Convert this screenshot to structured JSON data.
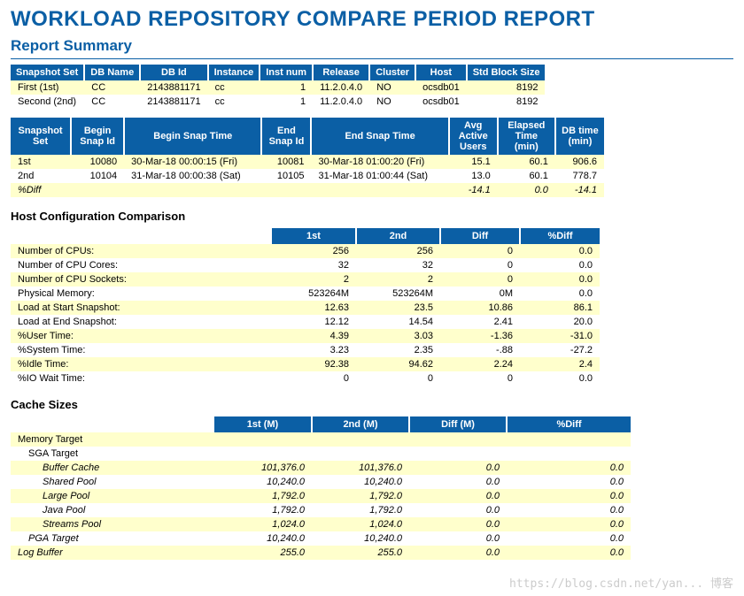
{
  "title": "WORKLOAD REPOSITORY COMPARE PERIOD REPORT",
  "summary_heading": "Report Summary",
  "snapshot_headers": [
    "Snapshot Set",
    "DB Name",
    "DB Id",
    "Instance",
    "Inst num",
    "Release",
    "Cluster",
    "Host",
    "Std Block Size"
  ],
  "snapshot_rows": [
    {
      "set": "First (1st)",
      "dbname": "CC",
      "dbid": "2143881171",
      "inst": "cc",
      "instnum": "1",
      "rel": "11.2.0.4.0",
      "cluster": "NO",
      "host": "ocsdb01",
      "block": "8192"
    },
    {
      "set": "Second (2nd)",
      "dbname": "CC",
      "dbid": "2143881171",
      "inst": "cc",
      "instnum": "1",
      "rel": "11.2.0.4.0",
      "cluster": "NO",
      "host": "ocsdb01",
      "block": "8192"
    }
  ],
  "snap_time_headers": [
    "Snapshot Set",
    "Begin Snap Id",
    "Begin Snap Time",
    "End Snap Id",
    "End Snap Time",
    "Avg Active Users",
    "Elapsed Time (min)",
    "DB time (min)"
  ],
  "snap_time_rows": [
    {
      "set": "1st",
      "bid": "10080",
      "btime": "30-Mar-18 00:00:15 (Fri)",
      "eid": "10081",
      "etime": "30-Mar-18 01:00:20 (Fri)",
      "aau": "15.1",
      "elapsed": "60.1",
      "dbtime": "906.6"
    },
    {
      "set": "2nd",
      "bid": "10104",
      "btime": "31-Mar-18 00:00:38 (Sat)",
      "eid": "10105",
      "etime": "31-Mar-18 01:00:44 (Sat)",
      "aau": "13.0",
      "elapsed": "60.1",
      "dbtime": "778.7"
    }
  ],
  "snap_diff": {
    "label": "%Diff",
    "aau": "-14.1",
    "elapsed": "0.0",
    "dbtime": "-14.1"
  },
  "hostconf_heading": "Host Configuration Comparison",
  "hostconf_headers": [
    "",
    "1st",
    "2nd",
    "Diff",
    "%Diff"
  ],
  "hostconf_rows": [
    {
      "n": "Number of CPUs:",
      "a": "256",
      "b": "256",
      "d": "0",
      "p": "0.0"
    },
    {
      "n": "Number of CPU Cores:",
      "a": "32",
      "b": "32",
      "d": "0",
      "p": "0.0"
    },
    {
      "n": "Number of CPU Sockets:",
      "a": "2",
      "b": "2",
      "d": "0",
      "p": "0.0"
    },
    {
      "n": "Physical Memory:",
      "a": "523264M",
      "b": "523264M",
      "d": "0M",
      "p": "0.0"
    },
    {
      "n": "Load at Start Snapshot:",
      "a": "12.63",
      "b": "23.5",
      "d": "10.86",
      "p": "86.1"
    },
    {
      "n": "Load at End Snapshot:",
      "a": "12.12",
      "b": "14.54",
      "d": "2.41",
      "p": "20.0"
    },
    {
      "n": "%User Time:",
      "a": "4.39",
      "b": "3.03",
      "d": "-1.36",
      "p": "-31.0"
    },
    {
      "n": "%System Time:",
      "a": "3.23",
      "b": "2.35",
      "d": "-.88",
      "p": "-27.2"
    },
    {
      "n": "%Idle Time:",
      "a": "92.38",
      "b": "94.62",
      "d": "2.24",
      "p": "2.4"
    },
    {
      "n": "%IO Wait Time:",
      "a": "0",
      "b": "0",
      "d": "0",
      "p": "0.0"
    }
  ],
  "cache_heading": "Cache Sizes",
  "cache_headers": [
    "",
    "1st (M)",
    "2nd (M)",
    "Diff (M)",
    "%Diff"
  ],
  "cache_rows": [
    {
      "n": "Memory Target",
      "a": "",
      "b": "",
      "d": "",
      "p": "",
      "cls": ""
    },
    {
      "n": "SGA Target",
      "a": "",
      "b": "",
      "d": "",
      "p": "",
      "cls": "indent1"
    },
    {
      "n": "Buffer Cache",
      "a": "101,376.0",
      "b": "101,376.0",
      "d": "0.0",
      "p": "0.0",
      "cls": "indent2 it"
    },
    {
      "n": "Shared Pool",
      "a": "10,240.0",
      "b": "10,240.0",
      "d": "0.0",
      "p": "0.0",
      "cls": "indent2 it"
    },
    {
      "n": "Large Pool",
      "a": "1,792.0",
      "b": "1,792.0",
      "d": "0.0",
      "p": "0.0",
      "cls": "indent2 it"
    },
    {
      "n": "Java Pool",
      "a": "1,792.0",
      "b": "1,792.0",
      "d": "0.0",
      "p": "0.0",
      "cls": "indent2 it"
    },
    {
      "n": "Streams Pool",
      "a": "1,024.0",
      "b": "1,024.0",
      "d": "0.0",
      "p": "0.0",
      "cls": "indent2 it"
    },
    {
      "n": "PGA Target",
      "a": "10,240.0",
      "b": "10,240.0",
      "d": "0.0",
      "p": "0.0",
      "cls": "indent1 it"
    },
    {
      "n": "Log Buffer",
      "a": "255.0",
      "b": "255.0",
      "d": "0.0",
      "p": "0.0",
      "cls": "it"
    }
  ],
  "watermark": "https://blog.csdn.net/yan... 博客"
}
